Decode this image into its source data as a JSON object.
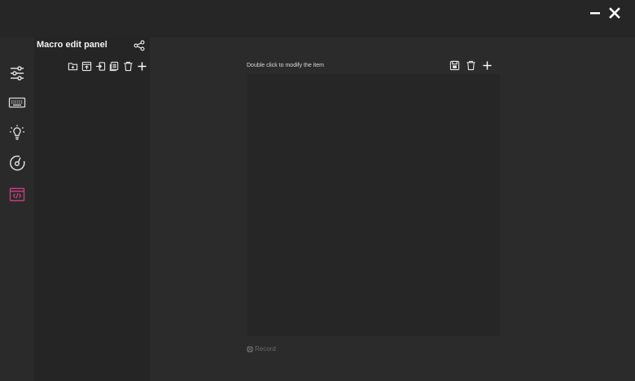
{
  "window": {
    "controls": [
      {
        "name": "minimize-icon",
        "symbol": "—"
      },
      {
        "name": "close-icon",
        "symbol": "✕"
      }
    ]
  },
  "sidebar": {
    "items": [
      {
        "name": "sidebar-item-settings",
        "icon": "sliders-icon",
        "active": false
      },
      {
        "name": "sidebar-item-keyboard",
        "icon": "keyboard-icon",
        "active": false
      },
      {
        "name": "sidebar-item-lighting",
        "icon": "lightbulb-icon",
        "active": false
      },
      {
        "name": "sidebar-item-performance",
        "icon": "gauge-icon",
        "active": false
      },
      {
        "name": "sidebar-item-macro",
        "icon": "code-window-icon",
        "active": true
      }
    ],
    "active_color": "#c23f7b",
    "icon_color": "#dcdcdc"
  },
  "left_panel": {
    "title": "Macro edit panel",
    "share_icon": "share-icon",
    "tools": [
      {
        "name": "new-folder-button",
        "icon": "folder-plus-icon"
      },
      {
        "name": "import-button",
        "icon": "import-icon"
      },
      {
        "name": "export-button",
        "icon": "export-icon"
      },
      {
        "name": "copy-button",
        "icon": "copy-icon"
      },
      {
        "name": "delete-button",
        "icon": "trash-icon"
      },
      {
        "name": "add-button",
        "icon": "plus-icon"
      }
    ]
  },
  "main": {
    "hint": "Double click to modify the item",
    "tools": [
      {
        "name": "save-button",
        "icon": "save-icon"
      },
      {
        "name": "delete-item-button",
        "icon": "trash-icon"
      },
      {
        "name": "add-item-button",
        "icon": "plus-icon"
      }
    ],
    "record_label": "Record"
  }
}
